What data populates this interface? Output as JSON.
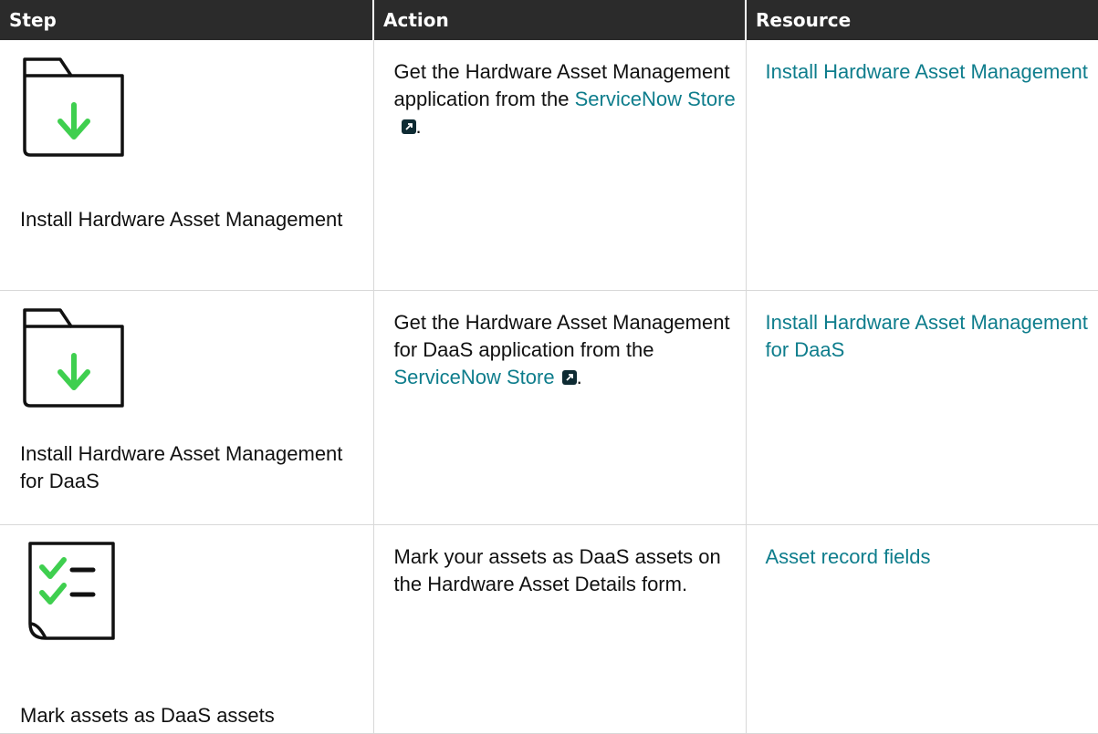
{
  "headers": {
    "step": "Step",
    "action": "Action",
    "resource": "Resource"
  },
  "colors": {
    "header_bg": "#2b2b2b",
    "link": "#0e7d8c",
    "icon_accent": "#3fcf4f"
  },
  "rows": [
    {
      "step_icon": "folder-download-icon",
      "step_label": "Install Hardware Asset Management",
      "action_before": "Get the Hardware Asset Management application from the ",
      "action_link": "ServiceNow Store",
      "action_after": ".",
      "resource_link": "Install Hardware Asset Management"
    },
    {
      "step_icon": "folder-download-icon",
      "step_label": "Install Hardware Asset Management for DaaS",
      "action_before": "Get the Hardware Asset Management for DaaS application from the ",
      "action_link": "ServiceNow Store",
      "action_after": ".",
      "resource_link": "Install Hardware Asset Management for DaaS"
    },
    {
      "step_icon": "checklist-document-icon",
      "step_label": "Mark assets as DaaS assets",
      "action_before": "Mark your assets as DaaS assets on the Hardware Asset Details form.",
      "action_link": "",
      "action_after": "",
      "resource_link": "Asset record fields"
    }
  ]
}
